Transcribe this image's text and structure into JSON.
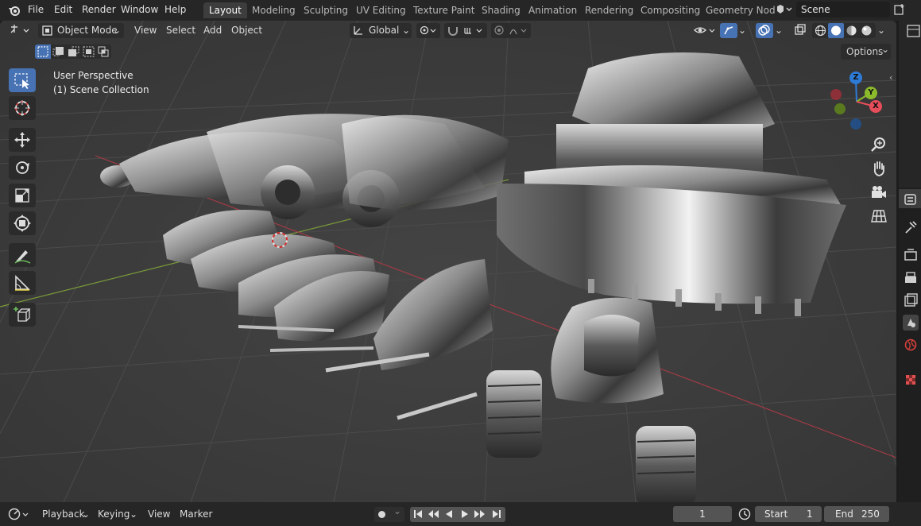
{
  "topbar": {
    "menus": [
      "File",
      "Edit",
      "Render",
      "Window",
      "Help"
    ],
    "workspace_tabs": [
      "Layout",
      "Modeling",
      "Sculpting",
      "UV Editing",
      "Texture Paint",
      "Shading",
      "Animation",
      "Rendering",
      "Compositing",
      "Geometry Nod"
    ],
    "active_tab": "Layout",
    "scene_name": "Scene"
  },
  "viewport_header": {
    "mode": "Object Mode",
    "menus": [
      "View",
      "Select",
      "Add",
      "Object"
    ],
    "transform_orientation": "Global",
    "options_label": "Options"
  },
  "viewport_overlay": {
    "perspective": "User Perspective",
    "collection": "(1) Scene Collection"
  },
  "gizmo": {
    "z": "Z",
    "y": "Y",
    "x": "X"
  },
  "toolbar_icons": [
    "select-box-icon",
    "cursor-icon",
    "move-icon",
    "rotate-icon",
    "scale-icon",
    "transform-icon",
    "annotate-icon",
    "measure-icon",
    "add-cube-icon"
  ],
  "timeline": {
    "menus": [
      "Playback",
      "Keying",
      "View",
      "Marker"
    ],
    "current_frame": "1",
    "start_label": "Start",
    "start_value": "1",
    "end_label": "End",
    "end_value": "250"
  },
  "colors": {
    "accent": "#4772b3",
    "axis_x": "#e64d5a",
    "axis_y": "#8bba2b",
    "axis_z": "#2e7bd6"
  }
}
